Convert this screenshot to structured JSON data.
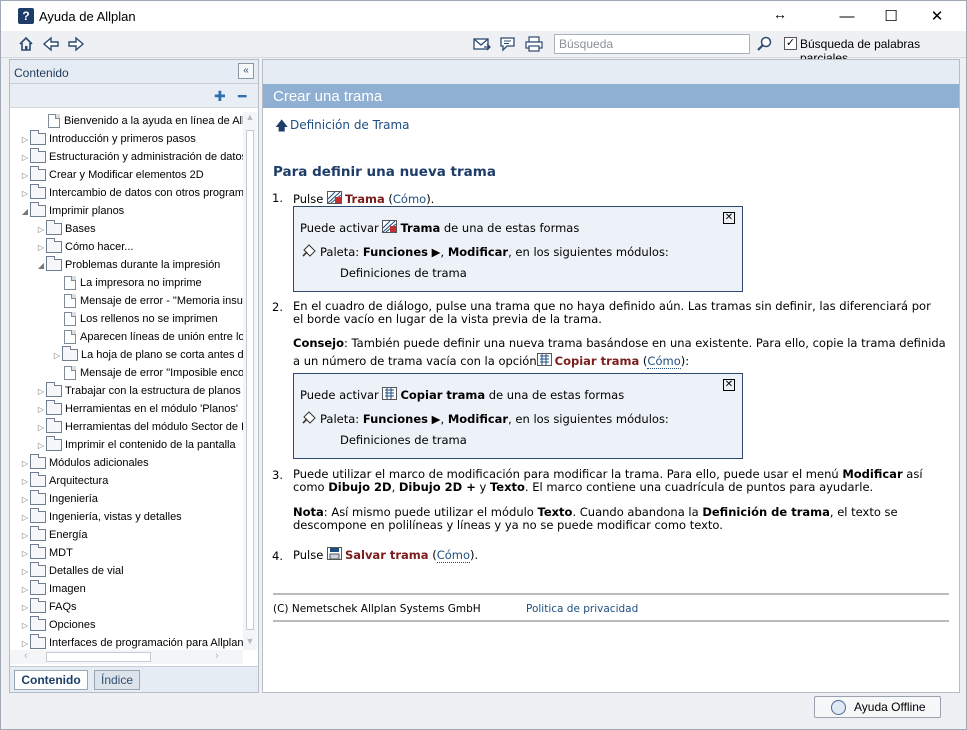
{
  "window": {
    "title": "Ayuda de Allplan"
  },
  "toolbar": {
    "search_placeholder": "Búsqueda",
    "partial_search_label": "Búsqueda de palabras parciales",
    "partial_search_checked": "✓"
  },
  "sidebar": {
    "title": "Contenido",
    "tree": [
      {
        "label": "Bienvenido a la ayuda en línea de Allplan",
        "level": 1,
        "kind": "page",
        "arrow": ""
      },
      {
        "label": "Introducción y primeros pasos",
        "level": 0,
        "kind": "folder",
        "arrow": "▷"
      },
      {
        "label": "Estructuración y administración de datos",
        "level": 0,
        "kind": "folder",
        "arrow": "▷"
      },
      {
        "label": "Crear y Modificar elementos 2D",
        "level": 0,
        "kind": "folder",
        "arrow": "▷"
      },
      {
        "label": "Intercambio de datos con otros programas",
        "level": 0,
        "kind": "folder",
        "arrow": "▷"
      },
      {
        "label": "Imprimir planos",
        "level": 0,
        "kind": "folder",
        "arrow": "◢"
      },
      {
        "label": "Bases",
        "level": 1,
        "kind": "folder",
        "arrow": "▷"
      },
      {
        "label": "Cómo hacer...",
        "level": 1,
        "kind": "folder",
        "arrow": "▷"
      },
      {
        "label": "Problemas durante la impresión",
        "level": 1,
        "kind": "folder",
        "arrow": "◢"
      },
      {
        "label": "La impresora no imprime",
        "level": 2,
        "kind": "page",
        "arrow": ""
      },
      {
        "label": "Mensaje de error - \"Memoria insuficiente\"",
        "level": 2,
        "kind": "page",
        "arrow": ""
      },
      {
        "label": "Los rellenos no se imprimen",
        "level": 2,
        "kind": "page",
        "arrow": ""
      },
      {
        "label": "Aparecen líneas de unión entre los",
        "level": 2,
        "kind": "page",
        "arrow": ""
      },
      {
        "label": "La hoja de plano se corta antes de",
        "level": 2,
        "kind": "folder",
        "arrow": "▷"
      },
      {
        "label": "Mensaje de error \"Imposible encontrar\"",
        "level": 2,
        "kind": "page",
        "arrow": ""
      },
      {
        "label": "Trabajar con la estructura de planos",
        "level": 1,
        "kind": "folder",
        "arrow": "▷"
      },
      {
        "label": "Herramientas en el módulo 'Planos'",
        "level": 1,
        "kind": "folder",
        "arrow": "▷"
      },
      {
        "label": "Herramientas del módulo Sector de Plano",
        "level": 1,
        "kind": "folder",
        "arrow": "▷"
      },
      {
        "label": "Imprimir el contenido de la pantalla",
        "level": 1,
        "kind": "folder",
        "arrow": "▷"
      },
      {
        "label": "Módulos adicionales",
        "level": 0,
        "kind": "folder",
        "arrow": "▷"
      },
      {
        "label": "Arquitectura",
        "level": 0,
        "kind": "folder",
        "arrow": "▷"
      },
      {
        "label": "Ingeniería",
        "level": 0,
        "kind": "folder",
        "arrow": "▷"
      },
      {
        "label": "Ingeniería, vistas y detalles",
        "level": 0,
        "kind": "folder",
        "arrow": "▷"
      },
      {
        "label": "Energía",
        "level": 0,
        "kind": "folder",
        "arrow": "▷"
      },
      {
        "label": "MDT",
        "level": 0,
        "kind": "folder",
        "arrow": "▷"
      },
      {
        "label": "Detalles de vial",
        "level": 0,
        "kind": "folder",
        "arrow": "▷"
      },
      {
        "label": "Imagen",
        "level": 0,
        "kind": "folder",
        "arrow": "▷"
      },
      {
        "label": "FAQs",
        "level": 0,
        "kind": "folder",
        "arrow": "▷"
      },
      {
        "label": "Opciones",
        "level": 0,
        "kind": "folder",
        "arrow": "▷"
      },
      {
        "label": "Interfaces de programación para Allplan",
        "level": 0,
        "kind": "folder",
        "arrow": "▷"
      }
    ],
    "tabs": {
      "contents": "Contenido",
      "index": "Índice"
    }
  },
  "content": {
    "header": "Crear una trama",
    "up_link": "Definición de Trama",
    "heading": "Para definir una nueva trama",
    "step1": {
      "num": "1.",
      "pulse": "Pulse",
      "link": "Trama",
      "open": " (",
      "como": "Cómo",
      "close": ")."
    },
    "box1": {
      "pre": "Puede activar",
      "cmd": "Trama",
      "post": "de una de estas formas",
      "palette": "Paleta:",
      "f1": "Funciones",
      "f2": "Modificar",
      "f3": ", en los siguientes módulos:",
      "module": "Definiciones de trama",
      "close": "✕"
    },
    "step2": {
      "num": "2.",
      "text": "En el cuadro de diálogo, pulse una trama que no haya definido aún. Las tramas sin definir, las diferenciará por el borde vacío en lugar de la vista previa de la trama."
    },
    "tip": {
      "label": "Consejo",
      "text": ": También puede definir una nueva trama basándose en una existente. Para ello, copie la trama definida a un número de trama vacía con la opción",
      "link": "Copiar trama",
      "open": " (",
      "como": "Cómo",
      "close": "):"
    },
    "box2": {
      "pre": "Puede activar",
      "cmd": "Copiar trama",
      "post": "de una de estas formas",
      "palette": "Paleta:",
      "f1": "Funciones",
      "f2": "Modificar",
      "f3": ", en los siguientes módulos:",
      "module": "Definiciones de trama",
      "close": "✕"
    },
    "step3": {
      "num": "3.",
      "t1": "Puede utilizar el marco de modificación para modificar la trama. Para ello, puede usar el menú",
      "b1": "Modificar",
      "t2": "así como",
      "b2": "Dibujo 2D",
      "t3": ",",
      "b3": "Dibujo 2D +",
      "t4": "y",
      "b4": "Texto",
      "t5": ". El marco contiene una cuadrícula de puntos para ayudarle."
    },
    "note": {
      "label": "Nota",
      "t1": ": Así mismo puede utilizar el módulo",
      "b1": "Texto",
      "t2": ". Cuando abandona la",
      "b2": "Definición de trama",
      "t3": ", el texto se descompone en polilíneas y líneas y ya no se puede modificar como texto."
    },
    "step4": {
      "num": "4.",
      "pulse": "Pulse",
      "link": "Salvar trama",
      "open": " (",
      "como": "Cómo",
      "close": ")."
    },
    "footer": {
      "copyright": "(C) Nemetschek Allplan Systems GmbH",
      "privacy": "Politica de privacidad"
    }
  },
  "status": {
    "offline_button": "Ayuda Offline"
  },
  "colors": {
    "header_bar": "#8fb0d2",
    "link": "#1d4d80",
    "command": "#7b1d1d",
    "heading": "#1d3d68"
  }
}
